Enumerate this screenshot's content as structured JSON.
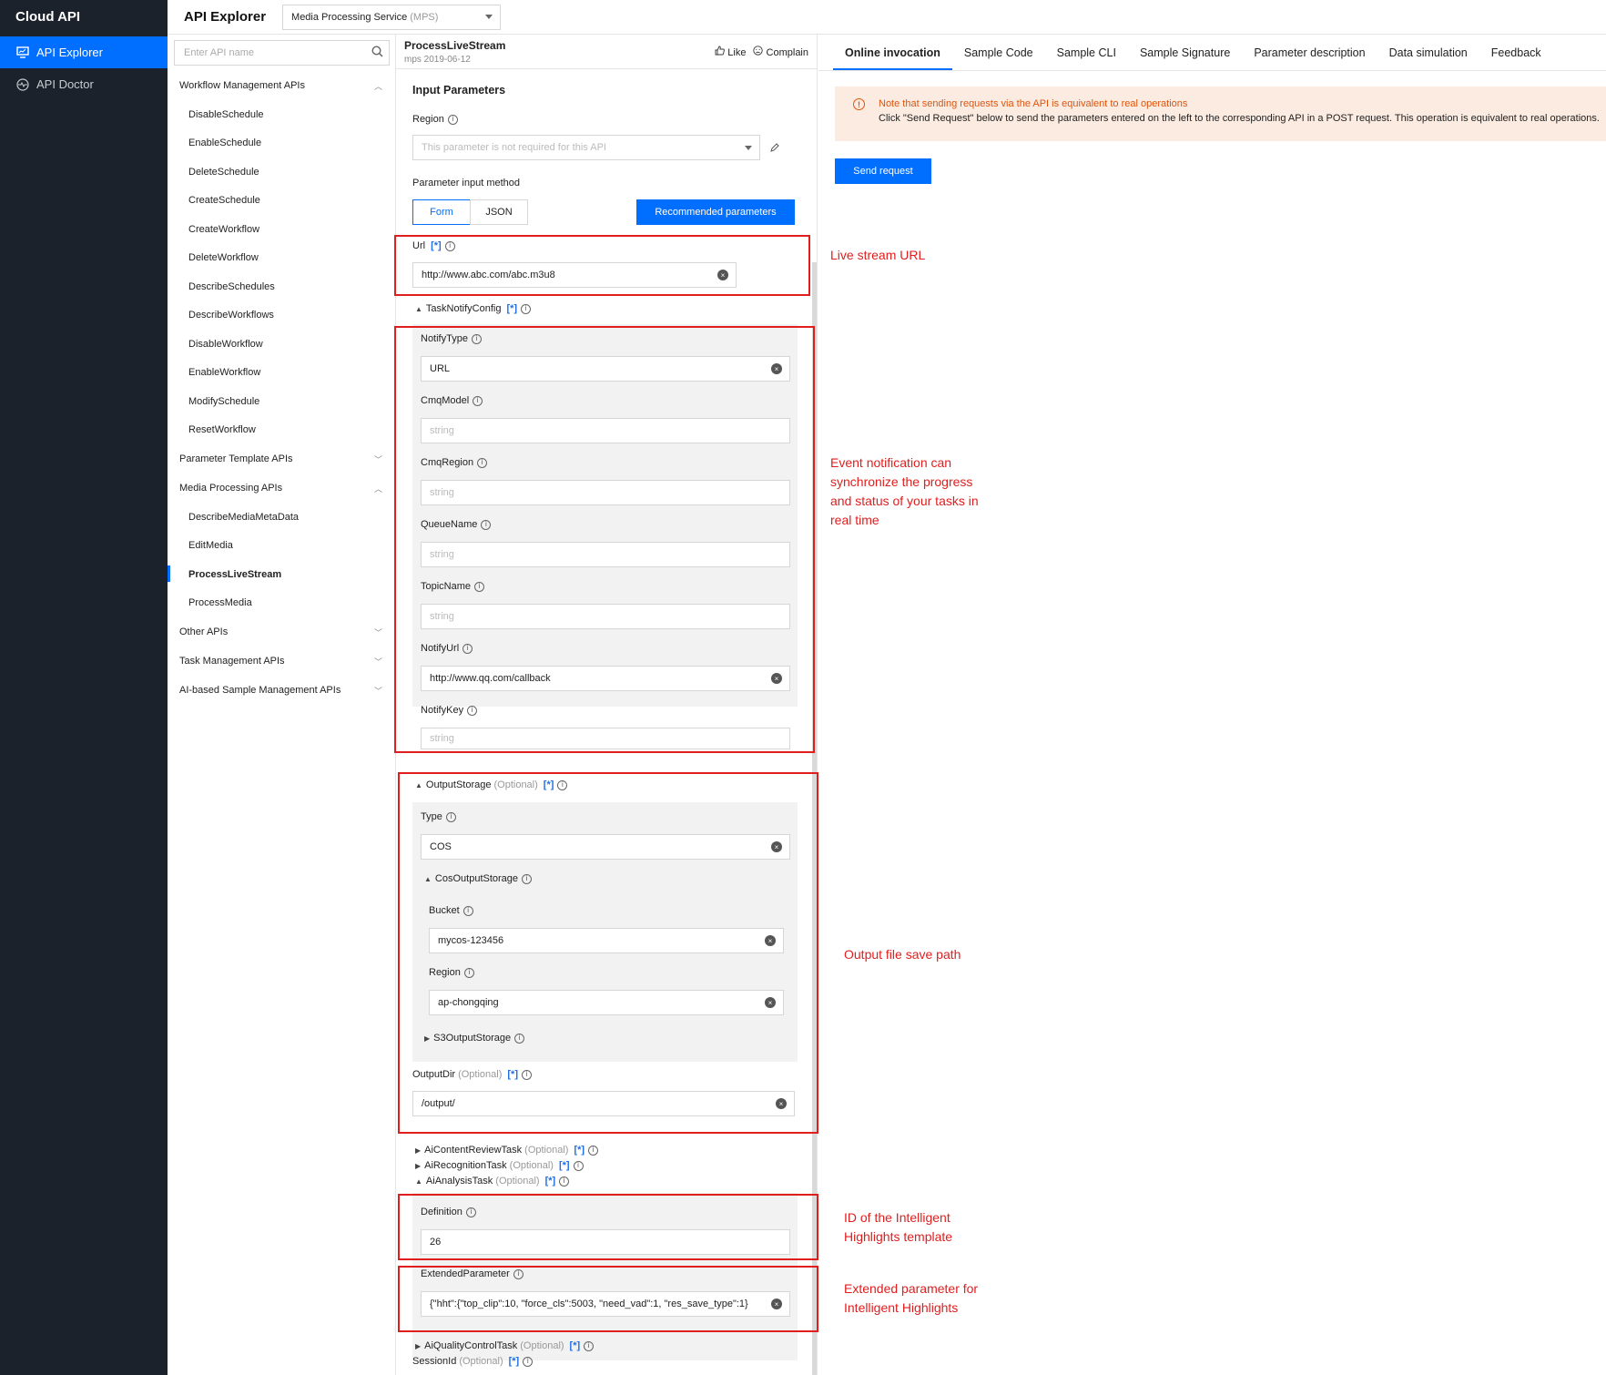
{
  "sidebar": {
    "logo": "Cloud API",
    "items": [
      {
        "label": "API Explorer",
        "icon": "monitor-icon"
      },
      {
        "label": "API Doctor",
        "icon": "pulse-icon"
      }
    ]
  },
  "topbar": {
    "title": "API Explorer",
    "service_name": "Media Processing Service",
    "service_abbr": "(MPS)"
  },
  "apilist": {
    "search_placeholder": "Enter API name",
    "groups": [
      {
        "label": "Workflow Management APIs",
        "expanded": true,
        "items": [
          "DisableSchedule",
          "EnableSchedule",
          "DeleteSchedule",
          "CreateSchedule",
          "CreateWorkflow",
          "DeleteWorkflow",
          "DescribeSchedules",
          "DescribeWorkflows",
          "DisableWorkflow",
          "EnableWorkflow",
          "ModifySchedule",
          "ResetWorkflow"
        ]
      },
      {
        "label": "Parameter Template APIs",
        "expanded": false,
        "items": []
      },
      {
        "label": "Media Processing APIs",
        "expanded": true,
        "items": [
          "DescribeMediaMetaData",
          "EditMedia",
          "ProcessLiveStream",
          "ProcessMedia"
        ]
      },
      {
        "label": "Other APIs",
        "expanded": false,
        "items": []
      },
      {
        "label": "Task Management APIs",
        "expanded": false,
        "items": []
      },
      {
        "label": "AI-based Sample Management APIs",
        "expanded": false,
        "items": []
      }
    ],
    "selected": "ProcessLiveStream"
  },
  "mid": {
    "api_name": "ProcessLiveStream",
    "version": "mps 2019-06-12",
    "like": "Like",
    "complain": "Complain",
    "section_title": "Input Parameters",
    "region_label": "Region",
    "region_placeholder": "This parameter is not required for this API",
    "input_method_label": "Parameter input method",
    "form_label": "Form",
    "json_label": "JSON",
    "recommended_label": "Recommended parameters",
    "star": "[*]",
    "optional": "(Optional)",
    "url_label": "Url",
    "url_value": "http://www.abc.com/abc.m3u8",
    "task_notify_label": "TaskNotifyConfig",
    "notify_type_label": "NotifyType",
    "notify_type_value": "URL",
    "cmq_model_label": "CmqModel",
    "cmq_region_label": "CmqRegion",
    "queue_name_label": "QueueName",
    "topic_name_label": "TopicName",
    "notify_url_label": "NotifyUrl",
    "notify_url_value": "http://www.qq.com/callback",
    "notify_key_label": "NotifyKey",
    "string_placeholder": "string",
    "output_storage_label": "OutputStorage",
    "type_label": "Type",
    "type_value": "COS",
    "cos_output_label": "CosOutputStorage",
    "bucket_label": "Bucket",
    "bucket_value": "mycos-123456",
    "cos_region_label": "Region",
    "cos_region_value": "ap-chongqing",
    "s3_output_label": "S3OutputStorage",
    "output_dir_label": "OutputDir",
    "output_dir_value": "/output/",
    "ai_content_review_label": "AiContentReviewTask",
    "ai_recognition_label": "AiRecognitionTask",
    "ai_analysis_label": "AiAnalysisTask",
    "definition_label": "Definition",
    "definition_value": "26",
    "extended_label": "ExtendedParameter",
    "extended_value": "{\"hht\":{\"top_clip\":10, \"force_cls\":5003, \"need_vad\":1, \"res_save_type\":1}",
    "ai_quality_label": "AiQualityControlTask",
    "session_id_label": "SessionId"
  },
  "right": {
    "tabs": [
      "Online invocation",
      "Sample Code",
      "Sample CLI",
      "Sample Signature",
      "Parameter description",
      "Data simulation",
      "Feedback"
    ],
    "active_tab": "Online invocation",
    "warn_line1": "Note that sending requests via the API is equivalent to real operations",
    "warn_line2": "Click \"Send Request\" below to send the parameters entered on the left to the corresponding API in a POST request. This operation is equivalent to real operations.",
    "send_label": "Send request"
  },
  "annotations": {
    "url_note": "Live stream URL",
    "notify_note": [
      "Event notification can",
      "synchronize the progress",
      "and status of your tasks in",
      "real time"
    ],
    "output_note": "Output file save path",
    "definition_note": [
      "ID of the Intelligent",
      "Highlights template"
    ],
    "extended_note": [
      "Extended parameter for",
      "Intelligent Highlights"
    ]
  },
  "colors": {
    "accent": "#006eff",
    "sidebar": "#1c222b",
    "annotation": "#e01e1e",
    "warning_bg": "#fcebe0"
  }
}
